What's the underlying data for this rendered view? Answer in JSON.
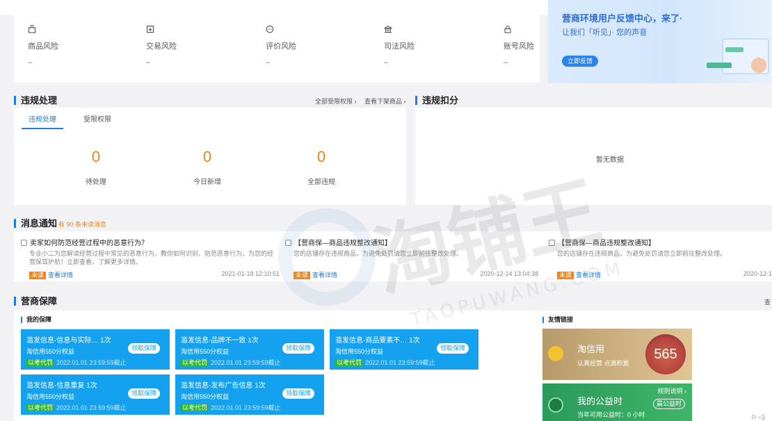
{
  "risk": {
    "items": [
      {
        "label": "商品风险",
        "value": "–",
        "icon": "bag-icon"
      },
      {
        "label": "交易风险",
        "value": "–",
        "icon": "download-box-icon"
      },
      {
        "label": "评价风险",
        "value": "–",
        "icon": "chat-bubble-icon"
      },
      {
        "label": "司法风险",
        "value": "–",
        "icon": "bank-icon"
      },
      {
        "label": "账号风险",
        "value": "–",
        "icon": "lock-icon"
      }
    ]
  },
  "banner": {
    "title": "营商环境用户反馈中心，来了·",
    "subtitle": "让我们「听见」· 您的声音",
    "button": "立即反馈"
  },
  "violation": {
    "title": "违规处理",
    "links": [
      "全部受限权限 ›",
      "查看下架商品 ›"
    ],
    "tabs": [
      "违规处理",
      "受限权限"
    ],
    "stats": [
      {
        "value": "0",
        "label": "待处理"
      },
      {
        "value": "0",
        "label": "今日新增"
      },
      {
        "value": "0",
        "label": "全部违规"
      }
    ]
  },
  "deduction": {
    "title": "违规扣分",
    "empty": "暂无数据"
  },
  "news": {
    "title": "消息通知",
    "unread": "有 90 条未读消息",
    "items": [
      {
        "title": "卖家如何防范经营过程中的恶意行为？",
        "desc": "专业小二为您解读经营过程中常见的恶意行为，教你如何识别、防范恶意行为，为您的经营保驾护航！立即查看，了解更多详情。",
        "badge": "未读",
        "link": "查看详情",
        "date": "2021-01-18 12:10:51"
      },
      {
        "title": "【营商保—商品违规整改通知】",
        "desc": "您的店铺存在违规商品，为避免处罚请您立即前往整改处理。",
        "badge": "未读",
        "link": "查看详情",
        "date": "2020-12-14 13:04:38"
      },
      {
        "title": "【营商保—商品违规整改通知】",
        "desc": "您的店铺存在违规商品，为避免处罚请您立即前往整改处理。",
        "badge": "未读",
        "link": "查看详情",
        "date": "2020-12-1"
      }
    ]
  },
  "guarantee": {
    "title": "营商保障",
    "right_link": "查",
    "my_title": "我的保障",
    "friend_title": "友情链接",
    "cards": [
      {
        "title": "滥发信息-信息与实际…  1次",
        "sub": "淘信用550分权益",
        "tag": "以考代罚",
        "date": "2022.01.01 23:59:59截止",
        "button": "领取保障"
      },
      {
        "title": "滥发信息-品牌不一致 1次",
        "sub": "淘信用550分权益",
        "tag": "以考代罚",
        "date": "2022.01.01 23:59:59截止",
        "button": "领取保障"
      },
      {
        "title": "滥发信息-商品要素不…  1次",
        "sub": "淘信用550分权益",
        "tag": "以考代罚",
        "date": "2022.01.01 23:59:59截止",
        "button": "领取保障"
      },
      {
        "title": "滥发信息-信息重复 1次",
        "sub": "淘信用550分权益",
        "tag": "以考代罚",
        "date": "2022.01.01 23:59:59截止",
        "button": "领取保障"
      },
      {
        "title": "滥发信息-发布广告信息 1次",
        "sub": "淘信用550分权益",
        "tag": "以考代罚",
        "date": "2022.01.01 23:59:59截止",
        "button": "领取保障"
      }
    ],
    "credit": {
      "name": "淘信用",
      "sub": "认真经营 点滴积累",
      "score": "565"
    },
    "charity": {
      "name": "我的公益时",
      "sub": "当年可用公益时：0 小时",
      "rule": "规则说明 ›",
      "button": "晨公益时"
    }
  },
  "watermark": {
    "brand": "淘铺王",
    "latin": "TAOPUWANG.COM"
  }
}
